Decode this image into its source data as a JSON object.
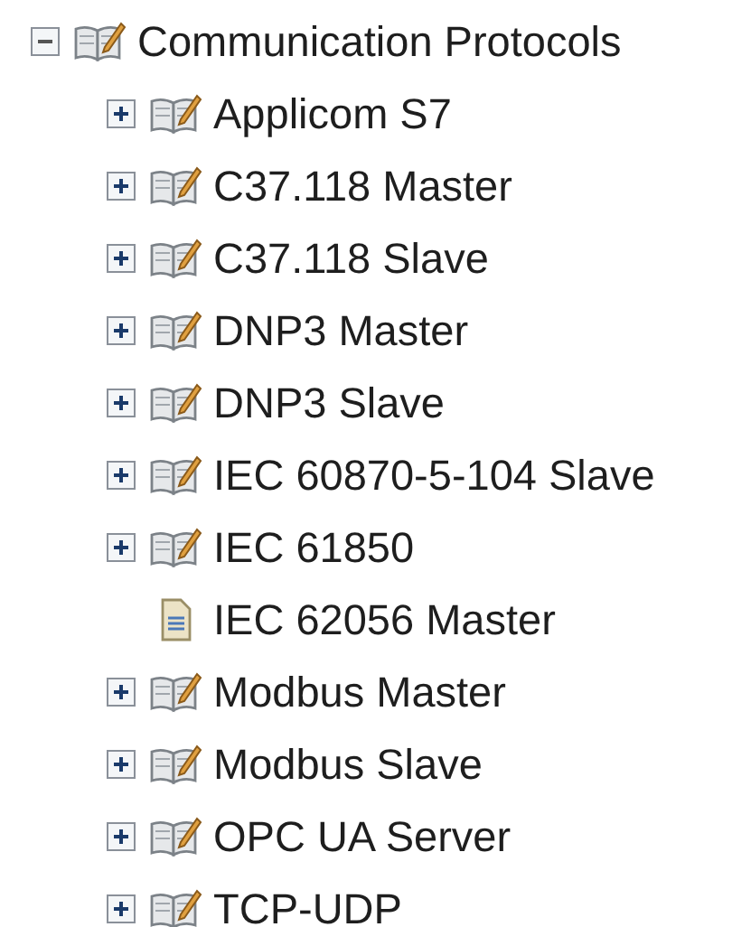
{
  "tree": {
    "label": "Communication Protocols",
    "kind": "book",
    "expanded": true,
    "children": [
      {
        "label": "Applicom S7",
        "kind": "book",
        "expanded": false
      },
      {
        "label": "C37.118 Master",
        "kind": "book",
        "expanded": false
      },
      {
        "label": "C37.118 Slave",
        "kind": "book",
        "expanded": false
      },
      {
        "label": "DNP3 Master",
        "kind": "book",
        "expanded": false
      },
      {
        "label": "DNP3 Slave",
        "kind": "book",
        "expanded": false
      },
      {
        "label": "IEC 60870-5-104 Slave",
        "kind": "book",
        "expanded": false
      },
      {
        "label": "IEC 61850",
        "kind": "book",
        "expanded": false
      },
      {
        "label": "IEC 62056 Master",
        "kind": "page"
      },
      {
        "label": "Modbus Master",
        "kind": "book",
        "expanded": false
      },
      {
        "label": "Modbus Slave",
        "kind": "book",
        "expanded": false
      },
      {
        "label": "OPC UA Server",
        "kind": "book",
        "expanded": false
      },
      {
        "label": "TCP-UDP",
        "kind": "book",
        "expanded": false
      }
    ]
  }
}
